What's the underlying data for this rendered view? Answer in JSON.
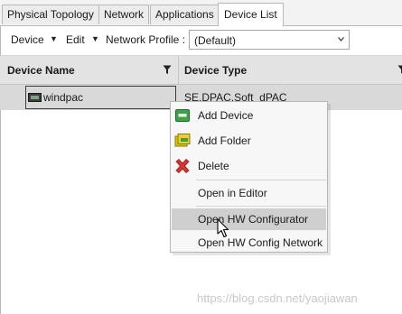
{
  "tabs": [
    {
      "label": "Physical Topology"
    },
    {
      "label": "Network"
    },
    {
      "label": "Applications"
    },
    {
      "label": "Device List"
    }
  ],
  "active_tab": "Device List",
  "toolbar": {
    "device_menu": "Device",
    "edit_menu": "Edit",
    "network_profile_label": "Network Profile :",
    "network_profile_value": "(Default)"
  },
  "grid": {
    "columns": [
      {
        "label": "Device Name"
      },
      {
        "label": "Device Type"
      }
    ],
    "rows": [
      {
        "name": "windpac",
        "type": "SE.DPAC.Soft_dPAC"
      }
    ]
  },
  "context_menu": {
    "items": [
      {
        "label": "Add Device",
        "icon": "add-device-icon"
      },
      {
        "label": "Add Folder",
        "icon": "add-folder-icon"
      },
      {
        "label": "Delete",
        "icon": "delete-x-icon"
      },
      {
        "label": "Open in Editor"
      },
      {
        "label": "Open HW Configurator",
        "highlighted": true
      },
      {
        "label": "Open HW Config Network"
      }
    ]
  },
  "watermark": "https://blog.csdn.net/yaojiawan",
  "colors": {
    "header_bg": "#e3e3e3",
    "selected_row_bg": "#d9d9d9",
    "menu_bg": "#f7f7f7",
    "menu_hover": "#cfcfcf",
    "delete_red": "#d9342b",
    "add_green": "#3ea04a",
    "folder_yellow": "#d7c21d"
  }
}
